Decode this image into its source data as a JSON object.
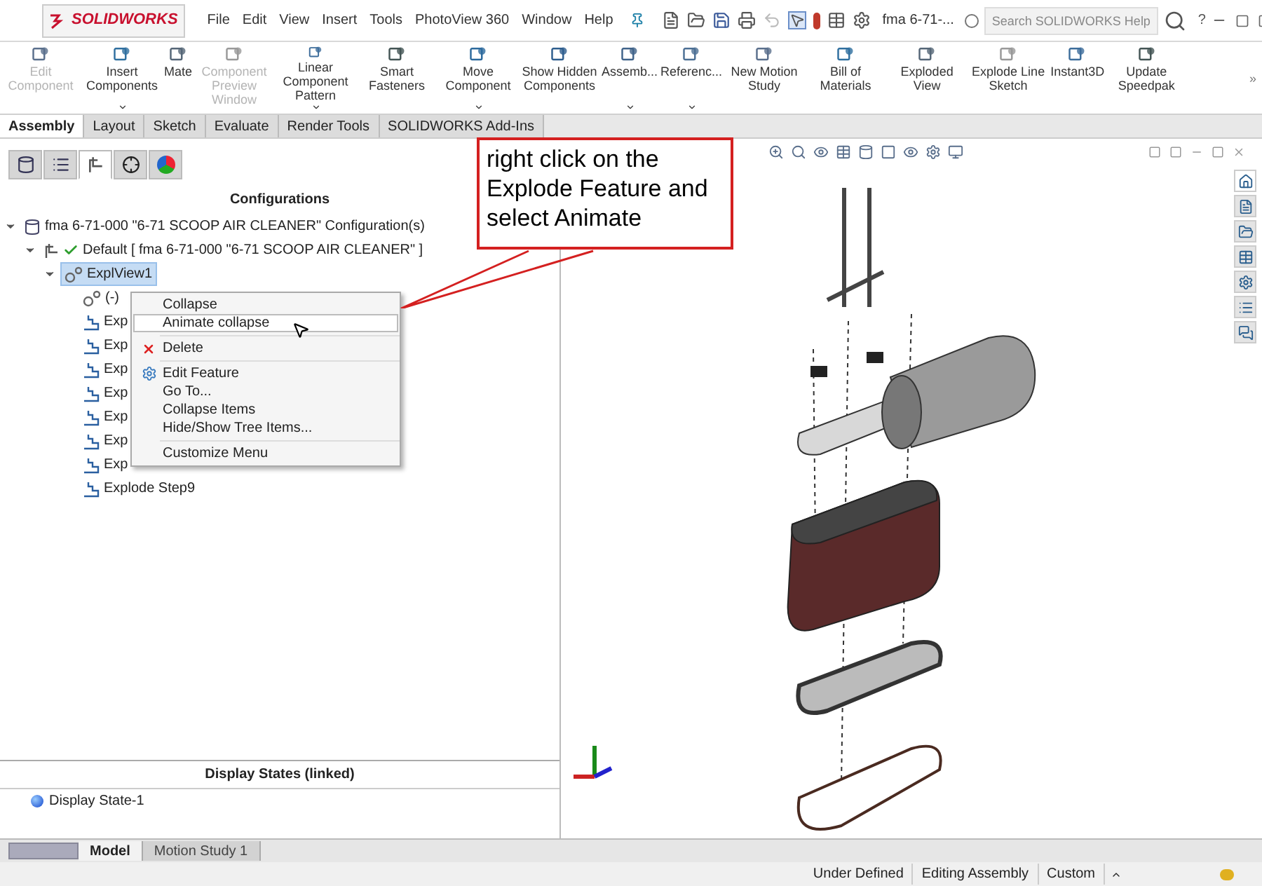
{
  "window": {
    "logo": "SOLIDWORKS",
    "menu": [
      "File",
      "Edit",
      "View",
      "Insert",
      "Tools",
      "PhotoView 360",
      "Window",
      "Help"
    ],
    "title": "fma 6-71-...",
    "search": {
      "placeholder": "Search SOLIDWORKS Help"
    },
    "help": "?"
  },
  "ribbon": {
    "buttons": [
      {
        "label": "Edit Component",
        "disabled": true,
        "dropdown": false
      },
      {
        "label": "Insert Components",
        "disabled": false,
        "dropdown": true
      },
      {
        "label": "Mate",
        "disabled": false,
        "dropdown": false
      },
      {
        "label": "Component Preview Window",
        "disabled": true,
        "dropdown": false
      },
      {
        "label": "Linear Component Pattern",
        "disabled": false,
        "dropdown": true
      },
      {
        "label": "Smart Fasteners",
        "disabled": false,
        "dropdown": false
      },
      {
        "label": "Move Component",
        "disabled": false,
        "dropdown": true
      },
      {
        "label": "Show Hidden Components",
        "disabled": false,
        "dropdown": false
      },
      {
        "label": "Assemb...",
        "disabled": false,
        "dropdown": true
      },
      {
        "label": "Referenc...",
        "disabled": false,
        "dropdown": true
      },
      {
        "label": "New Motion Study",
        "disabled": false,
        "dropdown": false
      },
      {
        "label": "Bill of Materials",
        "disabled": false,
        "dropdown": false
      },
      {
        "label": "Exploded View",
        "disabled": false,
        "dropdown": false
      },
      {
        "label": "Explode Line Sketch",
        "disabled": false,
        "dropdown": false
      },
      {
        "label": "Instant3D",
        "disabled": false,
        "dropdown": false
      },
      {
        "label": "Update Speedpak",
        "disabled": false,
        "dropdown": false
      }
    ],
    "more": "»"
  },
  "tabs": [
    {
      "label": "Assembly",
      "selected": true
    },
    {
      "label": "Layout",
      "selected": false
    },
    {
      "label": "Sketch",
      "selected": false
    },
    {
      "label": "Evaluate",
      "selected": false
    },
    {
      "label": "Render Tools",
      "selected": false
    },
    {
      "label": "SOLIDWORKS Add-Ins",
      "selected": false
    }
  ],
  "panel_tabs": [
    {
      "kind": "feature",
      "selected": false
    },
    {
      "kind": "property",
      "selected": false
    },
    {
      "kind": "config",
      "selected": true
    },
    {
      "kind": "dimxpert",
      "selected": false
    },
    {
      "kind": "display",
      "selected": false
    }
  ],
  "configurations": {
    "heading": "Configurations",
    "tree": [
      {
        "label": "fma 6-71-000 \"6-71 SCOOP AIR CLEANER\" Configuration(s)",
        "kind": "root",
        "expanded": true,
        "selected": false,
        "children": [
          {
            "label": "Default [ fma 6-71-000 \"6-71 SCOOP AIR CLEANER\" ]",
            "kind": "config",
            "expanded": true,
            "selected": false,
            "children": [
              {
                "label": "ExplView1",
                "kind": "explode",
                "expanded": true,
                "selected": true,
                "children": [
                  {
                    "label": "(-)",
                    "kind": "explode",
                    "selected": false
                  },
                  {
                    "label": "Exp",
                    "kind": "step",
                    "selected": false
                  },
                  {
                    "label": "Exp",
                    "kind": "step",
                    "selected": false
                  },
                  {
                    "label": "Exp",
                    "kind": "step",
                    "selected": false
                  },
                  {
                    "label": "Exp",
                    "kind": "step",
                    "selected": false
                  },
                  {
                    "label": "Exp",
                    "kind": "step",
                    "selected": false
                  },
                  {
                    "label": "Exp",
                    "kind": "step",
                    "selected": false
                  },
                  {
                    "label": "Exp",
                    "kind": "step",
                    "selected": false
                  },
                  {
                    "label": "Explode Step9",
                    "kind": "step",
                    "selected": false
                  }
                ]
              }
            ]
          }
        ]
      }
    ]
  },
  "context_menu": [
    {
      "kind": "item",
      "label": "Collapse",
      "selected": false
    },
    {
      "kind": "item",
      "label": "Animate collapse",
      "selected": true
    },
    {
      "kind": "separator"
    },
    {
      "kind": "delete",
      "label": "Delete",
      "selected": false
    },
    {
      "kind": "separator"
    },
    {
      "kind": "edit",
      "label": "Edit Feature",
      "selected": false
    },
    {
      "kind": "item",
      "label": "Go To...",
      "selected": false
    },
    {
      "kind": "item",
      "label": "Collapse Items",
      "selected": false
    },
    {
      "kind": "item",
      "label": "Hide/Show Tree Items...",
      "selected": false
    },
    {
      "kind": "separator"
    },
    {
      "kind": "item",
      "label": "Customize Menu",
      "selected": false
    }
  ],
  "callout": {
    "text": "right click on the Explode Feature and select Animate"
  },
  "display_states": {
    "heading": "Display States (linked)",
    "items": [
      "Display State-1"
    ]
  },
  "bottom_tabs": [
    {
      "label": "Model",
      "selected": true
    },
    {
      "label": "Motion Study 1",
      "selected": false
    }
  ],
  "task_pane": [
    {
      "kind": "home",
      "selected": true
    },
    {
      "kind": "document",
      "selected": false
    },
    {
      "kind": "folder",
      "selected": false
    },
    {
      "kind": "table",
      "selected": false
    },
    {
      "kind": "gear",
      "selected": false
    },
    {
      "kind": "list",
      "selected": false
    },
    {
      "kind": "chat",
      "selected": false
    }
  ],
  "status_bar": [
    "Under Defined",
    "Editing Assembly",
    "Custom"
  ]
}
